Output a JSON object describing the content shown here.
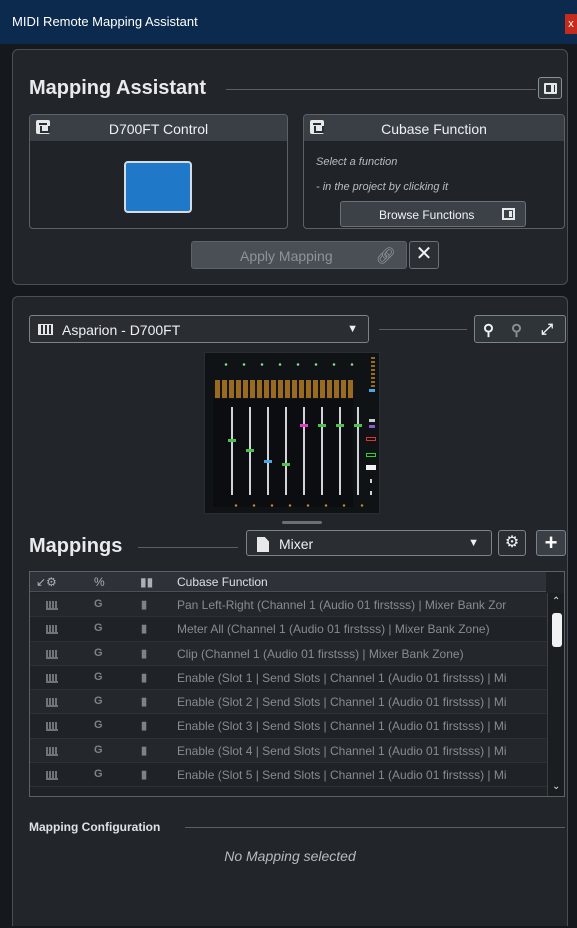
{
  "window": {
    "title": "MIDI Remote Mapping Assistant",
    "close_glyph": "x"
  },
  "assistant": {
    "heading": "Mapping Assistant",
    "control_panel": {
      "title": "D700FT Control"
    },
    "function_panel": {
      "title": "Cubase Function",
      "hint_line1": "Select a function",
      "hint_line2": "- in the project by clicking it",
      "browse_label": "Browse Functions"
    },
    "apply_label": "Apply Mapping",
    "cancel_glyph": "✕"
  },
  "mapper": {
    "device_select": {
      "value": "Asparion - D700FT"
    },
    "zoom": {
      "zoom_in": "🔍",
      "zoom_out": "🔍",
      "fit": "⤢"
    },
    "mappings_heading": "Mappings",
    "page_select": {
      "value": "Mixer"
    },
    "table": {
      "columns": [
        "",
        "",
        "",
        "Cubase Function"
      ],
      "rows": [
        {
          "g": "G",
          "function": "Pan Left-Right (Channel 1 (Audio 01 firstsss) | Mixer Bank Zor"
        },
        {
          "g": "G",
          "function": "Meter All (Channel 1 (Audio 01 firstsss) | Mixer Bank Zone)"
        },
        {
          "g": "G",
          "function": "Clip (Channel 1 (Audio 01 firstsss) | Mixer Bank Zone)"
        },
        {
          "g": "G",
          "function": "Enable (Slot 1 | Send Slots | Channel 1 (Audio 01 firstsss) | Mi"
        },
        {
          "g": "G",
          "function": "Enable (Slot 2 | Send Slots | Channel 1 (Audio 01 firstsss) | Mi"
        },
        {
          "g": "G",
          "function": "Enable (Slot 3 | Send Slots | Channel 1 (Audio 01 firstsss) | Mi"
        },
        {
          "g": "G",
          "function": "Enable (Slot 4 | Send Slots | Channel 1 (Audio 01 firstsss) | Mi"
        },
        {
          "g": "G",
          "function": "Enable (Slot 5 | Send Slots | Channel 1 (Audio 01 firstsss) | Mi"
        }
      ]
    },
    "config_heading": "Mapping Configuration",
    "no_mapping_text": "No Mapping selected"
  },
  "colors": {
    "accent_blue": "#1f78c8",
    "titlebar": "#0b2a4d",
    "close_red": "#c42b1c"
  }
}
